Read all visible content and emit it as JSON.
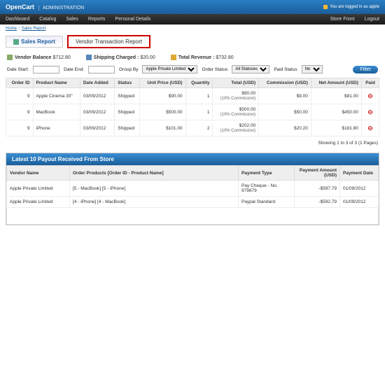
{
  "topbar": {
    "brand": "OpenCart",
    "sub": "ADMINISTRATION",
    "login": "You are logged in as apple"
  },
  "nav": {
    "items": [
      "Dashboard",
      "Catalog",
      "Sales",
      "Reports",
      "Personal Details"
    ],
    "right": [
      "Store Front",
      "Logout"
    ]
  },
  "breadcrumb": [
    "Home",
    "Sales Report"
  ],
  "tabs": {
    "active": "Sales Report",
    "boxed": "Vendor Transaction Report"
  },
  "summary": {
    "balance_lbl": "Vendor Balance",
    "balance": "$712.80",
    "ship_lbl": "Shipping Charged :",
    "ship": "$20.00",
    "rev_lbl": "Total Revenue :",
    "rev": "$732.80"
  },
  "filters": {
    "date_start_lbl": "Date Start:",
    "date_end_lbl": "Date End:",
    "group_lbl": "Group By",
    "group_val": "Apple Private Limited",
    "status_lbl": "Order Status",
    "status_val": "All Statuses",
    "paid_lbl": "Paid Status",
    "paid_val": "No",
    "btn": "Filter"
  },
  "cols": {
    "oid": "Order ID",
    "pname": "Product Name",
    "date": "Date Added",
    "status": "Status",
    "unit": "Unit Price (USD)",
    "qty": "Quantity",
    "total": "Total (USD)",
    "comm": "Commission (USD)",
    "net": "Net Amount (USD)",
    "paid": "Paid"
  },
  "rows": [
    {
      "oid": "9",
      "pname": "Apple Cinema 30\"",
      "date": "03/09/2012",
      "status": "Shipped",
      "unit": "$90.00",
      "qty": "1",
      "total": "$90.00",
      "totalsub": "(10% Commission)",
      "comm": "$9.00",
      "net": "$81.00"
    },
    {
      "oid": "9",
      "pname": "MacBook",
      "date": "03/09/2012",
      "status": "Shipped",
      "unit": "$500.00",
      "qty": "1",
      "total": "$500.00",
      "totalsub": "(10% Commission)",
      "comm": "$50.00",
      "net": "$450.00"
    },
    {
      "oid": "9",
      "pname": "iPhone",
      "date": "03/09/2012",
      "status": "Shipped",
      "unit": "$101.00",
      "qty": "2",
      "total": "$202.00",
      "totalsub": "(10% Commission)",
      "comm": "$20.20",
      "net": "$181.80"
    }
  ],
  "pager": "Showing 1 to 3 of 3 (1 Pages)",
  "payout": {
    "title": "Latest 10 Payout Received From Store",
    "cols": {
      "vendor": "Vendor Name",
      "order": "Order Products [Order ID - Product Name]",
      "ptype": "Payment Type",
      "pamt": "Payment Amount (USD)",
      "pdate": "Payment Date"
    },
    "rows": [
      {
        "vendor": "Apple Private Limited",
        "order": "[5 - MacBook] [5 - iPhone]",
        "ptype": "Pay Cheque - No. 979879",
        "pamt": "-$597.79",
        "pdate": "01/09/2012"
      },
      {
        "vendor": "Apple Private Limited",
        "order": "[4 - iPhone] [4 - MacBook]",
        "ptype": "Paypal Standard",
        "pamt": "-$592.79",
        "pdate": "01/09/2012"
      }
    ]
  },
  "chart_data": {
    "type": "table",
    "title": "Vendor Transaction Report",
    "columns": [
      "Order ID",
      "Product Name",
      "Date Added",
      "Status",
      "Unit Price (USD)",
      "Quantity",
      "Total (USD)",
      "Commission (USD)",
      "Net Amount (USD)"
    ],
    "rows": [
      [
        9,
        "Apple Cinema 30\"",
        "03/09/2012",
        "Shipped",
        90.0,
        1,
        90.0,
        9.0,
        81.0
      ],
      [
        9,
        "MacBook",
        "03/09/2012",
        "Shipped",
        500.0,
        1,
        500.0,
        50.0,
        450.0
      ],
      [
        9,
        "iPhone",
        "03/09/2012",
        "Shipped",
        101.0,
        2,
        202.0,
        20.2,
        181.8
      ]
    ]
  }
}
